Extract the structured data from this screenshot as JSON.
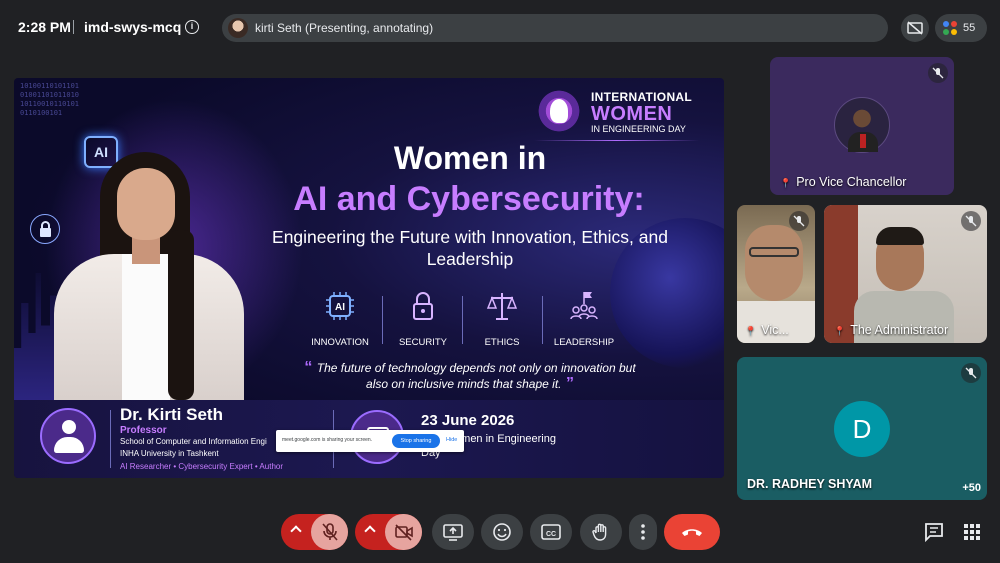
{
  "meeting": {
    "time": "2:28 PM",
    "code": "imd-swys-mcq",
    "presenter": "kirti Seth (Presenting, annotating)",
    "participant_count": "55"
  },
  "slide": {
    "badge_line1": "INTERNATIONAL",
    "badge_line2": "WOMEN",
    "badge_line3": "IN ENGINEERING DAY",
    "ai_chip": "AI",
    "title_line1": "Women in",
    "title_line2": "AI and Cybersecurity:",
    "subtitle": "Engineering the Future with Innovation, Ethics, and Leadership",
    "pillars": [
      {
        "label": "INNOVATION",
        "icon": "ai-chip-icon"
      },
      {
        "label": "SECURITY",
        "icon": "lock-icon"
      },
      {
        "label": "ETHICS",
        "icon": "scales-icon"
      },
      {
        "label": "LEADERSHIP",
        "icon": "leadership-icon"
      }
    ],
    "quote": "The future of technology depends not only on innovation but also on inclusive minds that shape it.",
    "speaker_name": "Dr. Kirti Seth",
    "speaker_role": "Professor",
    "speaker_school": "School of Computer and Information Engi",
    "speaker_university": "INHA University in Tashkent",
    "speaker_tags": "AI Researcher  •  Cybersecurity Expert  •  Author",
    "event_date": "23 June 2026",
    "event_name": "onal Women in Engineering Day",
    "binary": "1010011010110101001101011010101100101101010110100101"
  },
  "share_notice": {
    "text": "meet.google.com is sharing your screen.",
    "stop_label": "Stop sharing",
    "hide_label": "Hide"
  },
  "participants": {
    "pro_vc": "Pro Vice Chancellor",
    "vic": "Vic...",
    "admin": "The Administrator",
    "dr": "DR. RADHEY SHYAM",
    "dr_initial": "D",
    "more": "+50"
  },
  "colors": {
    "accent_purple": "#c77dff",
    "end_call_red": "#ea4335",
    "muted_red": "#c5221f",
    "tile_teal": "#1a5d63"
  }
}
